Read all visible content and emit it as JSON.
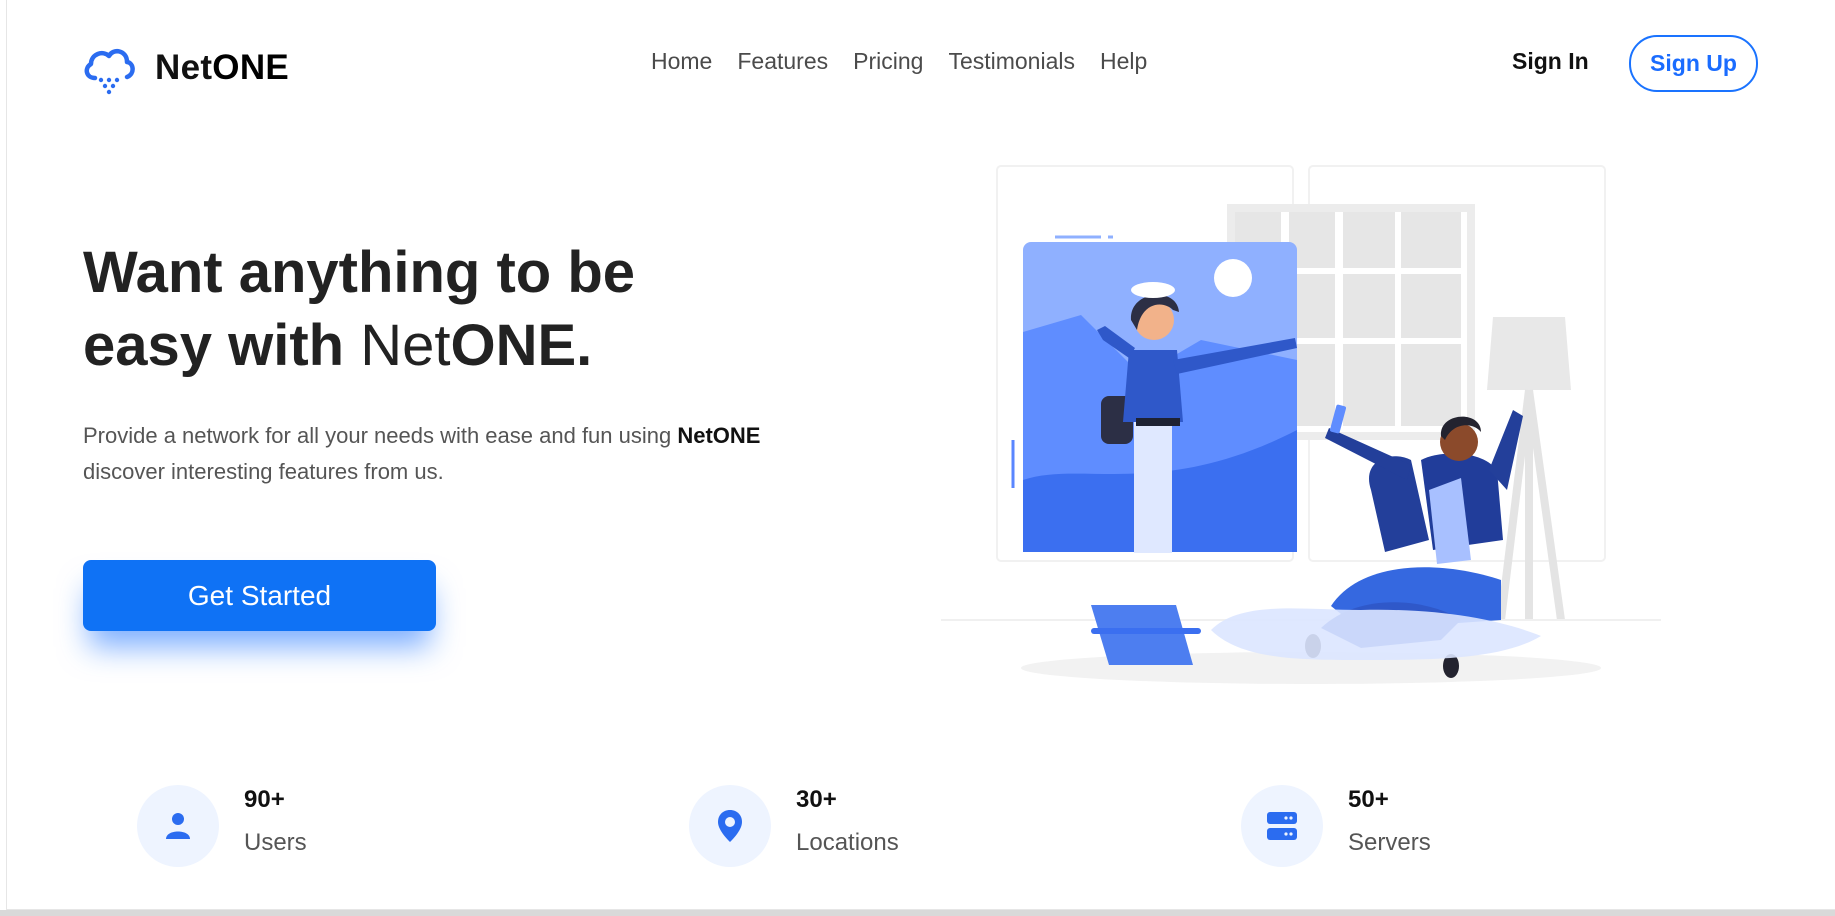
{
  "brand": {
    "name_part1": "Net",
    "name_part2": "ONE",
    "icon": "cloud-icon",
    "accent_color": "#1a6cff"
  },
  "nav": {
    "items": [
      {
        "label": "Home"
      },
      {
        "label": "Features"
      },
      {
        "label": "Pricing"
      },
      {
        "label": "Testimonials"
      },
      {
        "label": "Help"
      }
    ],
    "sign_in": "Sign In",
    "sign_up": "Sign Up"
  },
  "hero": {
    "title_line1": "Want anything to be",
    "title_line2_prefix": "easy with ",
    "title_brand_light": "Net",
    "title_brand_bold": "ONE.",
    "subtitle_prefix": "Provide a network for all your needs with ease and fun using ",
    "subtitle_brand": "NetONE",
    "subtitle_suffix": "discover interesting features from us.",
    "cta_label": "Get Started",
    "cta_color": "#0f72f5"
  },
  "stats": [
    {
      "value": "90+",
      "label": "Users",
      "icon": "user-icon"
    },
    {
      "value": "30+",
      "label": "Locations",
      "icon": "location-pin-icon"
    },
    {
      "value": "50+",
      "label": "Servers",
      "icon": "server-icon"
    }
  ]
}
